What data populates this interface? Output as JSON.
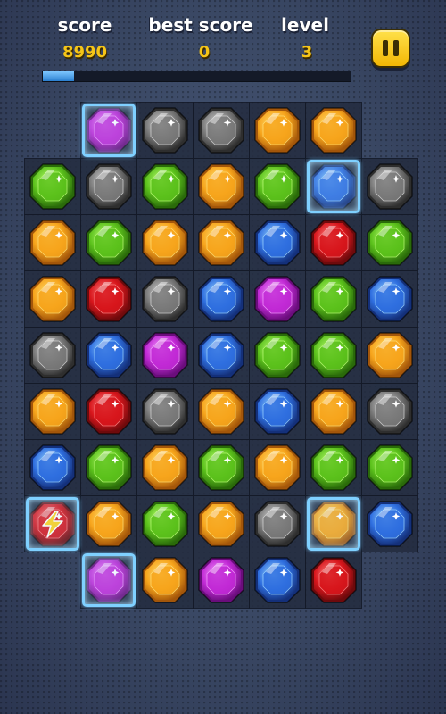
{
  "hud": {
    "score_label": "score",
    "score_value": "8990",
    "best_label": "best score",
    "best_value": "0",
    "level_label": "level",
    "level_value": "3",
    "progress": 0.1,
    "pause_icon": "pause-icon"
  },
  "colors": {
    "gem": {
      "purple": [
        "#f6a3ff",
        "#c22ad6",
        "#6a0d7c"
      ],
      "gray": [
        "#d9d9d9",
        "#7a7a7a",
        "#2e2e2e"
      ],
      "orange": [
        "#ffe27a",
        "#f7a51c",
        "#a3560a"
      ],
      "green": [
        "#bfff7a",
        "#5cc21c",
        "#2a6a0a"
      ],
      "blue": [
        "#9fd8ff",
        "#2f6fe0",
        "#14307a"
      ],
      "red": [
        "#ff8a8a",
        "#d8161c",
        "#6e0a0c"
      ]
    }
  },
  "board": {
    "rows": [
      [
        null,
        "purple",
        "gray",
        "gray",
        "orange",
        "orange",
        null
      ],
      [
        "green",
        "gray",
        "green",
        "orange",
        "green",
        "blue",
        "gray"
      ],
      [
        "orange",
        "green",
        "orange",
        "orange",
        "blue",
        "red",
        "green"
      ],
      [
        "orange",
        "red",
        "gray",
        "blue",
        "purple",
        "green",
        "blue"
      ],
      [
        "gray",
        "blue",
        "purple",
        "blue",
        "green",
        "green",
        "orange"
      ],
      [
        "orange",
        "red",
        "gray",
        "orange",
        "blue",
        "orange",
        "gray"
      ],
      [
        "blue",
        "green",
        "orange",
        "green",
        "orange",
        "green",
        "green"
      ],
      [
        "red",
        "orange",
        "green",
        "orange",
        "gray",
        "orange",
        "blue"
      ],
      [
        null,
        "purple",
        "orange",
        "purple",
        "blue",
        "red",
        null
      ]
    ],
    "ice": [
      [
        0,
        1
      ],
      [
        1,
        5
      ],
      [
        7,
        0
      ],
      [
        7,
        5
      ],
      [
        8,
        1
      ]
    ],
    "special": [
      [
        7,
        0,
        "lightning-bomb"
      ]
    ]
  }
}
